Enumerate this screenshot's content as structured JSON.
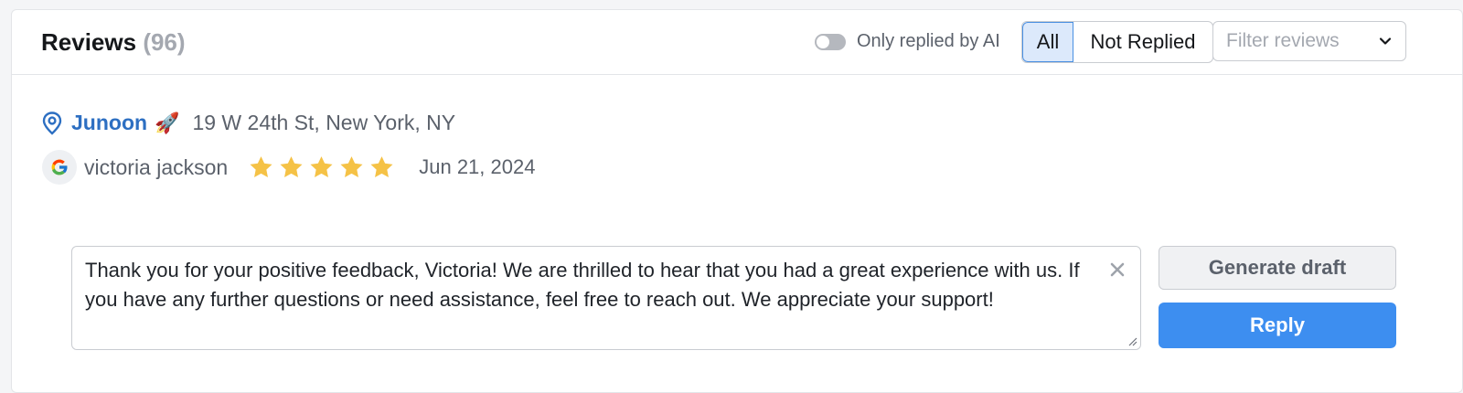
{
  "header": {
    "title": "Reviews",
    "count": "(96)",
    "toggle_label": "Only replied by AI",
    "toggle_on": false,
    "segments": [
      "All",
      "Not Replied"
    ],
    "active_segment": "All",
    "filter_placeholder": "Filter reviews"
  },
  "review": {
    "location_name": "Junoon",
    "location_emoji": "🚀",
    "address": "19 W 24th St, New York, NY",
    "source_icon": "google-icon",
    "author": "victoria jackson",
    "rating": 5,
    "date": "Jun 21, 2024"
  },
  "reply": {
    "text": "Thank you for your positive feedback, Victoria! We are thrilled to hear that you had a great experience with us. If you have any further questions or need assistance, feel free to reach out. We appreciate your support!",
    "generate_label": "Generate draft",
    "reply_label": "Reply"
  },
  "colors": {
    "accent": "#3d8ef0",
    "link": "#2d6fc2",
    "star": "#f5c246"
  }
}
